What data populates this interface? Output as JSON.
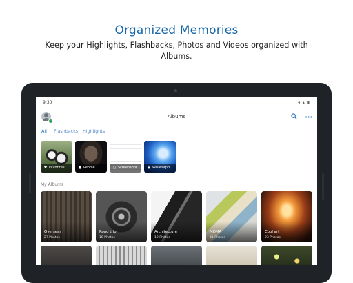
{
  "promo": {
    "title": "Organized Memories",
    "subtitle": "Keep your Highlights, Flashbacks, Photos and Videos organized with Albums."
  },
  "status_bar": {
    "time": "9:30",
    "icons": "◂ ▴ ▮"
  },
  "app_bar": {
    "title": "Albums",
    "search_icon": "search-icon",
    "more_icon": "more-icon",
    "more_glyph": "•••"
  },
  "tabs": [
    {
      "label": "All",
      "active": true
    },
    {
      "label": "Flashbacks",
      "active": false
    },
    {
      "label": "Highlights",
      "active": false
    }
  ],
  "highlights": [
    {
      "label": "Favorites",
      "icon": "heart-icon",
      "glyph": "♥"
    },
    {
      "label": "People",
      "icon": "person-icon",
      "glyph": "●"
    },
    {
      "label": "Screenshot",
      "icon": "screenshot-icon",
      "glyph": "▢"
    },
    {
      "label": "Whatsapp",
      "icon": "whatsapp-icon",
      "glyph": "◉"
    }
  ],
  "my_albums": {
    "heading": "My Albums",
    "items": [
      {
        "name": "Overseas",
        "count": "27 Photos"
      },
      {
        "name": "Road trip",
        "count": "18 Photos"
      },
      {
        "name": "Architecture",
        "count": "12 Photos"
      },
      {
        "name": "MOMA",
        "count": "41 Photos"
      },
      {
        "name": "Cool art",
        "count": "23 Photos"
      }
    ]
  },
  "colors": {
    "accent": "#1a6fb5",
    "title_blue": "#1767a8",
    "device": "#1f2328"
  }
}
